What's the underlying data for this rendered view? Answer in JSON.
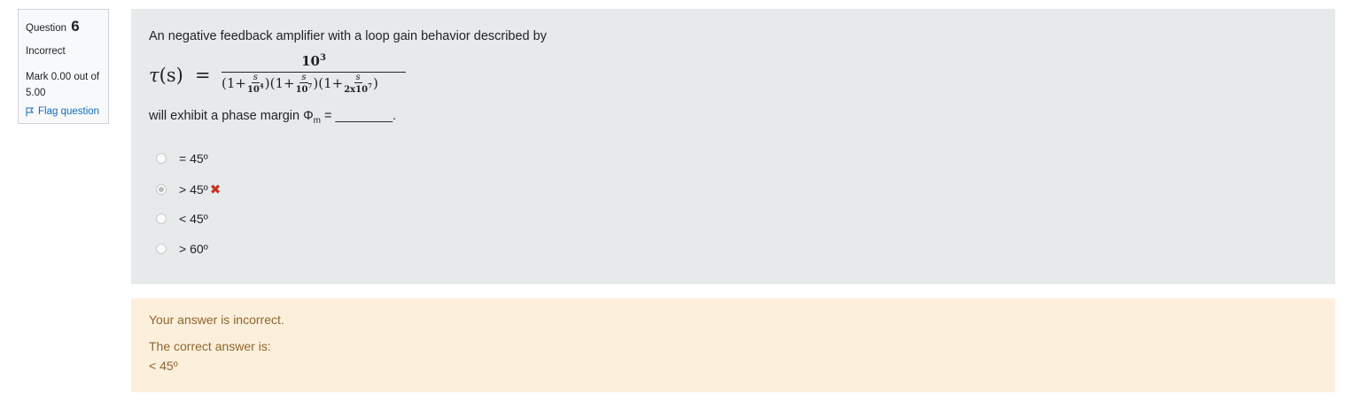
{
  "info": {
    "question_label": "Question",
    "question_number": "6",
    "state": "Incorrect",
    "grade": "Mark 0.00 out of 5.00",
    "flag_label": "Flag question"
  },
  "question": {
    "prompt": "An negative feedback amplifier with a loop gain behavior described by",
    "formula": {
      "lhs_symbol": "τ",
      "lhs_arg": "(s)",
      "equals": "=",
      "numerator_base": "10",
      "numerator_exp": "3",
      "den": {
        "p1_open": "(1+",
        "t1_num": "s",
        "t1_base": "10",
        "t1_exp": "4",
        "p2_open": ")(1+",
        "t2_num": "s",
        "t2_base": "10",
        "t2_exp": "7",
        "p3_open": ")(1+",
        "t3_num": "s",
        "t3_base": "2x10",
        "t3_exp": "7",
        "close": ")"
      }
    },
    "exhibit_prefix": "will exhibit a phase margin Φ",
    "exhibit_sub": "m",
    "exhibit_suffix": " = ________."
  },
  "options": [
    {
      "label": "= 45º",
      "selected": false
    },
    {
      "label": "> 45º",
      "selected": true,
      "mark": "✖"
    },
    {
      "label": "< 45º",
      "selected": false
    },
    {
      "label": "> 60º",
      "selected": false
    }
  ],
  "feedback": {
    "status": "Your answer is incorrect.",
    "correct_label": "The correct answer is:",
    "correct_value": "< 45º"
  },
  "colors": {
    "formulation_bg": "#e7eaeb",
    "feedback_bg": "#fcefdc",
    "feedback_text": "#8e662e",
    "link": "#0f6cbf",
    "incorrect_mark": "#ca3120"
  }
}
